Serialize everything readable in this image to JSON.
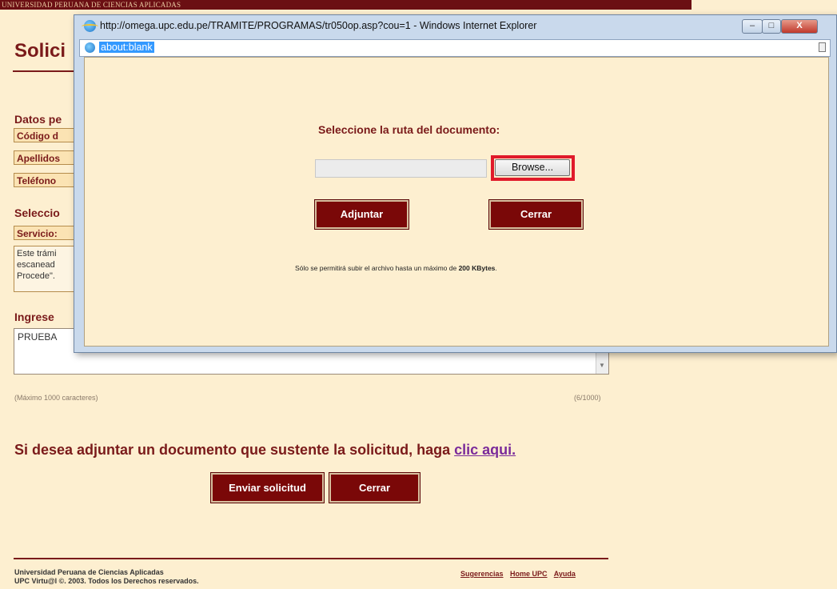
{
  "background_page": {
    "topbar_text": "UNIVERSIDAD PERUANA DE CIENCIAS APLICADAS",
    "title": "Solici",
    "datos_heading": "Datos pe",
    "fields": [
      "Código d",
      "Apellidos",
      "Teléfono"
    ],
    "seleccion_heading": "Seleccio",
    "servicio_label": "Servicio:",
    "description_lines": [
      "Este trámi",
      "escanead",
      "Procede\"."
    ],
    "ingrese_heading": "Ingrese",
    "textarea_value": "PRUEBA",
    "char_hint": "(Máximo 1000 caracteres)",
    "char_count": "(6/1000)",
    "attach_prompt": "Si desea adjuntar un documento que sustente la solicitud, haga",
    "attach_link": "clic aqui.",
    "send_button": "Enviar solicitud",
    "close_button": "Cerrar",
    "footer_line1": "Universidad Peruana de Ciencias Aplicadas",
    "footer_line2": "UPC Virtu@l ©. 2003. Todos los Derechos reservados.",
    "footer_links": [
      "Sugerencias",
      "Home UPC",
      "Ayuda"
    ]
  },
  "popup": {
    "window_title": "http://omega.upc.edu.pe/TRAMITE/PROGRAMAS/tr050op.asp?cou=1 - Windows Internet Explorer",
    "address": "about:blank",
    "heading": "Seleccione la ruta del documento:",
    "browse_label": "Browse...",
    "attach_button": "Adjuntar",
    "close_button": "Cerrar",
    "note_prefix": "Sólo se permitirá subir el archivo hasta un máximo de",
    "note_limit": "200 KBytes",
    "note_suffix": ".",
    "window_controls": {
      "minimize": "–",
      "maximize": "□",
      "close": "X"
    }
  },
  "colors": {
    "page_background": "#fdefd0",
    "brand_maroon": "#7a1a1a",
    "button_background": "#7a0808",
    "highlight_red": "#e01a2a"
  }
}
